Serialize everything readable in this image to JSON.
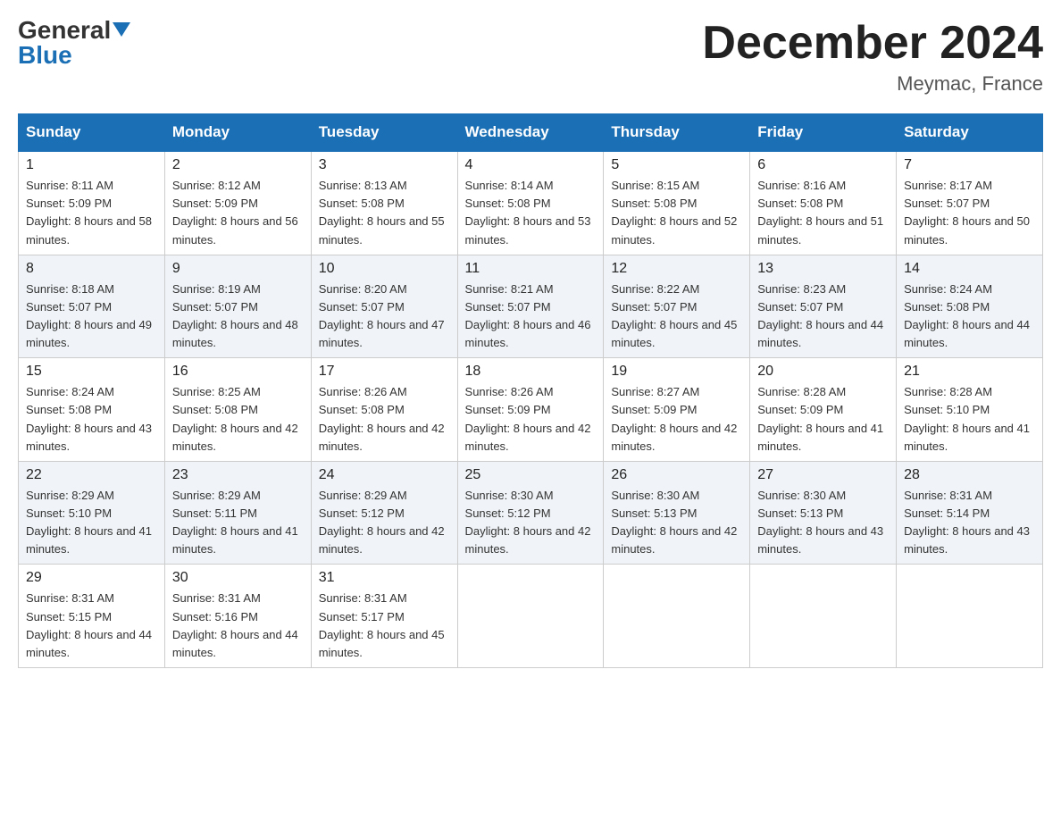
{
  "header": {
    "logo_general": "General",
    "logo_blue": "Blue",
    "month_title": "December 2024",
    "location": "Meymac, France"
  },
  "columns": [
    "Sunday",
    "Monday",
    "Tuesday",
    "Wednesday",
    "Thursday",
    "Friday",
    "Saturday"
  ],
  "weeks": [
    [
      {
        "day": "1",
        "sunrise": "8:11 AM",
        "sunset": "5:09 PM",
        "daylight": "8 hours and 58 minutes."
      },
      {
        "day": "2",
        "sunrise": "8:12 AM",
        "sunset": "5:09 PM",
        "daylight": "8 hours and 56 minutes."
      },
      {
        "day": "3",
        "sunrise": "8:13 AM",
        "sunset": "5:08 PM",
        "daylight": "8 hours and 55 minutes."
      },
      {
        "day": "4",
        "sunrise": "8:14 AM",
        "sunset": "5:08 PM",
        "daylight": "8 hours and 53 minutes."
      },
      {
        "day": "5",
        "sunrise": "8:15 AM",
        "sunset": "5:08 PM",
        "daylight": "8 hours and 52 minutes."
      },
      {
        "day": "6",
        "sunrise": "8:16 AM",
        "sunset": "5:08 PM",
        "daylight": "8 hours and 51 minutes."
      },
      {
        "day": "7",
        "sunrise": "8:17 AM",
        "sunset": "5:07 PM",
        "daylight": "8 hours and 50 minutes."
      }
    ],
    [
      {
        "day": "8",
        "sunrise": "8:18 AM",
        "sunset": "5:07 PM",
        "daylight": "8 hours and 49 minutes."
      },
      {
        "day": "9",
        "sunrise": "8:19 AM",
        "sunset": "5:07 PM",
        "daylight": "8 hours and 48 minutes."
      },
      {
        "day": "10",
        "sunrise": "8:20 AM",
        "sunset": "5:07 PM",
        "daylight": "8 hours and 47 minutes."
      },
      {
        "day": "11",
        "sunrise": "8:21 AM",
        "sunset": "5:07 PM",
        "daylight": "8 hours and 46 minutes."
      },
      {
        "day": "12",
        "sunrise": "8:22 AM",
        "sunset": "5:07 PM",
        "daylight": "8 hours and 45 minutes."
      },
      {
        "day": "13",
        "sunrise": "8:23 AM",
        "sunset": "5:07 PM",
        "daylight": "8 hours and 44 minutes."
      },
      {
        "day": "14",
        "sunrise": "8:24 AM",
        "sunset": "5:08 PM",
        "daylight": "8 hours and 44 minutes."
      }
    ],
    [
      {
        "day": "15",
        "sunrise": "8:24 AM",
        "sunset": "5:08 PM",
        "daylight": "8 hours and 43 minutes."
      },
      {
        "day": "16",
        "sunrise": "8:25 AM",
        "sunset": "5:08 PM",
        "daylight": "8 hours and 42 minutes."
      },
      {
        "day": "17",
        "sunrise": "8:26 AM",
        "sunset": "5:08 PM",
        "daylight": "8 hours and 42 minutes."
      },
      {
        "day": "18",
        "sunrise": "8:26 AM",
        "sunset": "5:09 PM",
        "daylight": "8 hours and 42 minutes."
      },
      {
        "day": "19",
        "sunrise": "8:27 AM",
        "sunset": "5:09 PM",
        "daylight": "8 hours and 42 minutes."
      },
      {
        "day": "20",
        "sunrise": "8:28 AM",
        "sunset": "5:09 PM",
        "daylight": "8 hours and 41 minutes."
      },
      {
        "day": "21",
        "sunrise": "8:28 AM",
        "sunset": "5:10 PM",
        "daylight": "8 hours and 41 minutes."
      }
    ],
    [
      {
        "day": "22",
        "sunrise": "8:29 AM",
        "sunset": "5:10 PM",
        "daylight": "8 hours and 41 minutes."
      },
      {
        "day": "23",
        "sunrise": "8:29 AM",
        "sunset": "5:11 PM",
        "daylight": "8 hours and 41 minutes."
      },
      {
        "day": "24",
        "sunrise": "8:29 AM",
        "sunset": "5:12 PM",
        "daylight": "8 hours and 42 minutes."
      },
      {
        "day": "25",
        "sunrise": "8:30 AM",
        "sunset": "5:12 PM",
        "daylight": "8 hours and 42 minutes."
      },
      {
        "day": "26",
        "sunrise": "8:30 AM",
        "sunset": "5:13 PM",
        "daylight": "8 hours and 42 minutes."
      },
      {
        "day": "27",
        "sunrise": "8:30 AM",
        "sunset": "5:13 PM",
        "daylight": "8 hours and 43 minutes."
      },
      {
        "day": "28",
        "sunrise": "8:31 AM",
        "sunset": "5:14 PM",
        "daylight": "8 hours and 43 minutes."
      }
    ],
    [
      {
        "day": "29",
        "sunrise": "8:31 AM",
        "sunset": "5:15 PM",
        "daylight": "8 hours and 44 minutes."
      },
      {
        "day": "30",
        "sunrise": "8:31 AM",
        "sunset": "5:16 PM",
        "daylight": "8 hours and 44 minutes."
      },
      {
        "day": "31",
        "sunrise": "8:31 AM",
        "sunset": "5:17 PM",
        "daylight": "8 hours and 45 minutes."
      },
      null,
      null,
      null,
      null
    ]
  ]
}
